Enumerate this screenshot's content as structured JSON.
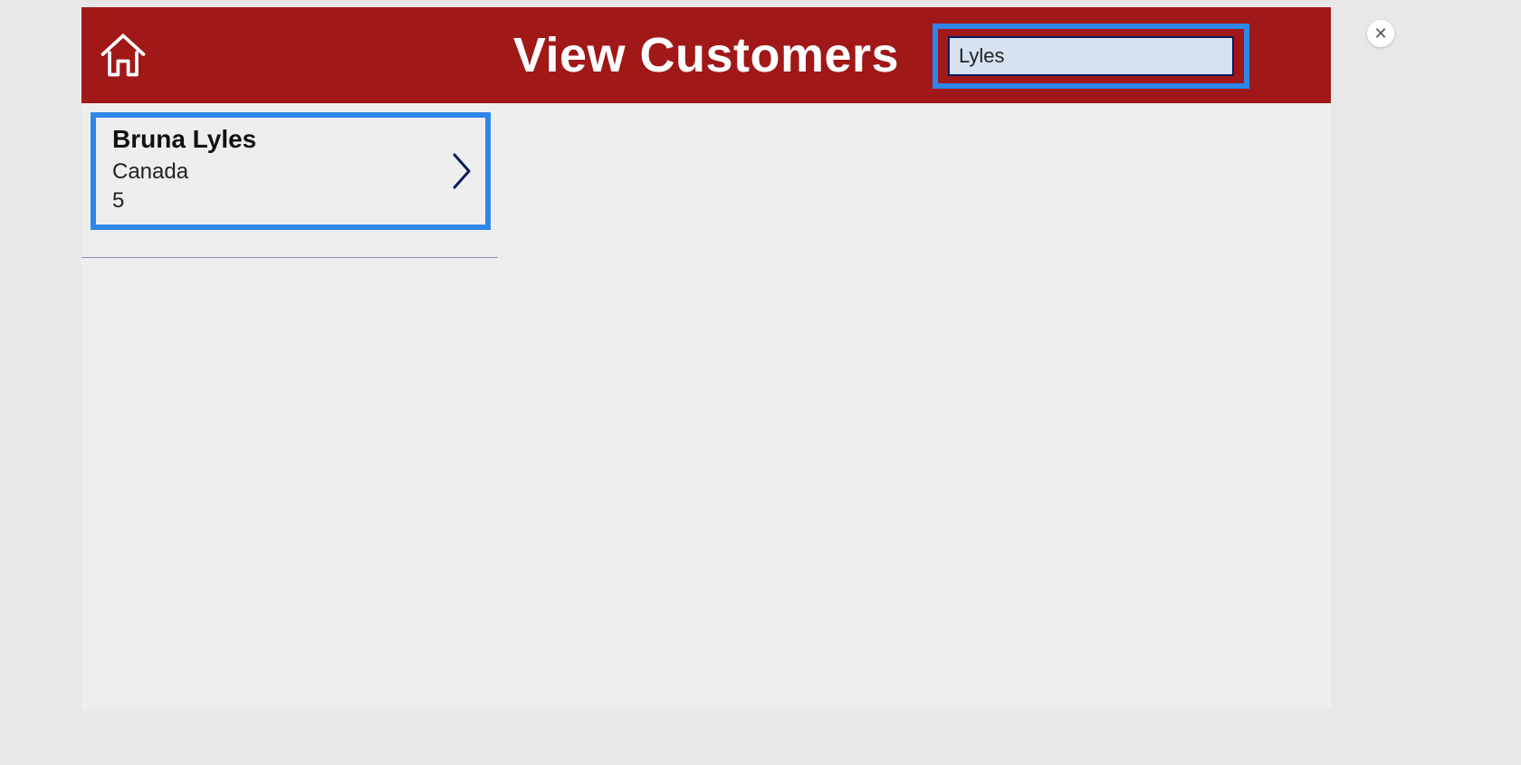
{
  "header": {
    "title": "View Customers",
    "search_value": "Lyles"
  },
  "customers": [
    {
      "name": "Bruna  Lyles",
      "country": "Canada",
      "id": "5"
    }
  ],
  "close_label": "✕"
}
